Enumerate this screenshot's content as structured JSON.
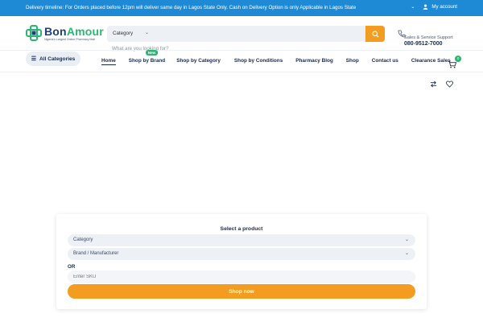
{
  "topbar": {
    "message": "Delivery timeline: For Orders placed before 12pm will deliver same day in Lagos State Only. Cash on Delivery Option is only Applicable in Lagos State",
    "account_label": "My account"
  },
  "header": {
    "logo_name_a": "Bon",
    "logo_name_b": "Amour",
    "logo_tagline": "Nigeria's Largest Online Pharmacy Mall",
    "search": {
      "category_label": "Category",
      "placeholder": "What are you looking for?"
    },
    "support": {
      "label": "Sales & Service Support",
      "phone": "080-9512-7000"
    }
  },
  "nav": {
    "all_categories": "All Categories",
    "items": [
      {
        "label": "Home"
      },
      {
        "label": "Shop by Brand"
      },
      {
        "label": "Shop by Category"
      },
      {
        "label": "Shop by Conditions"
      },
      {
        "label": "Pharmacy Blog"
      },
      {
        "label": "Shop"
      },
      {
        "label": "Contact us"
      },
      {
        "label": "Clearance Sales"
      }
    ],
    "new_badge": "New",
    "cart_count": "0"
  },
  "selector": {
    "title": "Select a product",
    "category": "Category",
    "brand": "Brand / Manufacturer",
    "or_label": "OR",
    "sku_placeholder": "Enter SKU",
    "shop_now": "Shop now"
  },
  "colors": {
    "topbar": "#1e8ad6",
    "accent": "#f39c1f",
    "brand_green": "#2bb673",
    "navy": "#1c2b4a"
  }
}
